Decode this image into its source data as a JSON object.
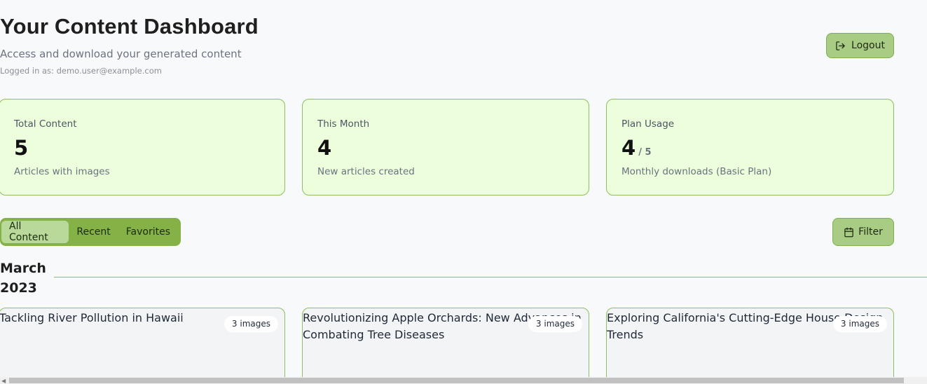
{
  "header": {
    "title": "Your Content Dashboard",
    "subtitle": "Access and download your generated content",
    "logged_in": "Logged in as: demo.user@example.com",
    "logout_label": "Logout"
  },
  "stats": [
    {
      "label": "Total Content",
      "value": "5",
      "suffix": "",
      "description": "Articles with images"
    },
    {
      "label": "This Month",
      "value": "4",
      "suffix": "",
      "description": "New articles created"
    },
    {
      "label": "Plan Usage",
      "value": "4",
      "suffix": "/ 5",
      "description": "Monthly downloads (Basic Plan)"
    }
  ],
  "tabs": {
    "items": [
      "All Content",
      "Recent",
      "Favorites"
    ],
    "active": "All Content"
  },
  "filter_label": "Filter",
  "section": {
    "month": "March 2023"
  },
  "articles": [
    {
      "title": "Tackling River Pollution in Hawaii",
      "badge": "3 images"
    },
    {
      "title": "Revolutionizing Apple Orchards: New Advances in Combating Tree Diseases",
      "badge": "3 images"
    },
    {
      "title": "Exploring California's Cutting-Edge House Design Trends",
      "badge": "3 images"
    }
  ],
  "colors": {
    "accent": "#84b247",
    "button_bg": "#a9cc84",
    "card_bg": "#ecfedb",
    "card_border": "#8bbf5f"
  },
  "icons": {
    "logout": "logout-icon",
    "filter": "calendar-icon"
  }
}
